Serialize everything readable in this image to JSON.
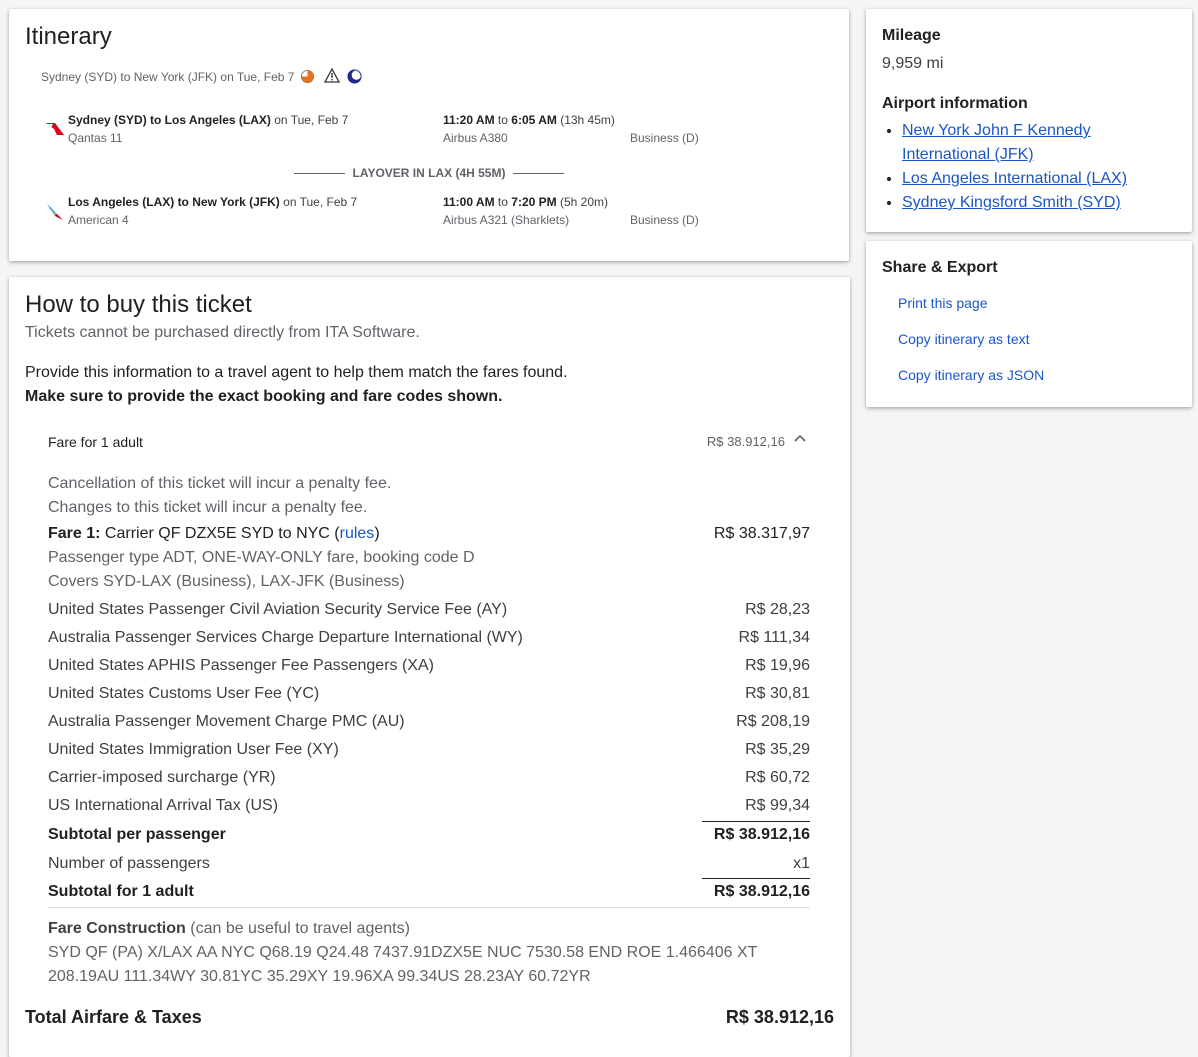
{
  "itinerary": {
    "title": "Itinerary",
    "summary": "Sydney (SYD) to New York (JFK) on Tue, Feb 7",
    "segments": [
      {
        "route": "Sydney (SYD) to Los Angeles (LAX)",
        "date": " on Tue, Feb 7",
        "flight": "Qantas 11",
        "dep": "11:20 AM",
        "to": " to ",
        "arr": "6:05 AM",
        "duration": " (13h 45m)",
        "aircraft": "Airbus A380",
        "cabin": "Business (D)"
      },
      {
        "route": "Los Angeles (LAX) to New York (JFK)",
        "date": " on Tue, Feb 7",
        "flight": "American 4",
        "dep": "11:00 AM",
        "to": " to ",
        "arr": "7:20 PM",
        "duration": " (5h 20m)",
        "aircraft": "Airbus A321 (Sharklets)",
        "cabin": "Business (D)"
      }
    ],
    "layover": "LAYOVER IN LAX (4H 55M)"
  },
  "buy": {
    "title": "How to buy this ticket",
    "subtitle": "Tickets cannot be purchased directly from ITA Software.",
    "info": "Provide this information to a travel agent to help them match the fares found.",
    "info_bold": "Make sure to provide the exact booking and fare codes shown.",
    "fare_for": "Fare for 1 adult",
    "fare_for_amount": "R$ 38.912,16",
    "cancel_note": "Cancellation of this ticket will incur a penalty fee.",
    "change_note": "Changes to this ticket will incur a penalty fee.",
    "fare1_label": "Fare 1:",
    "fare1_text": " Carrier QF DZX5E SYD to NYC (",
    "fare1_rules": "rules",
    "fare1_close": ")",
    "fare1_amount": "R$ 38.317,97",
    "passenger_type": "Passenger type ADT, ONE-WAY-ONLY fare, booking code D",
    "covers": "Covers SYD-LAX (Business), LAX-JFK (Business)",
    "taxes": [
      {
        "label": "United States Passenger Civil Aviation Security Service Fee (AY)",
        "amount": "R$ 28,23"
      },
      {
        "label": "Australia Passenger Services Charge Departure International (WY)",
        "amount": "R$ 111,34"
      },
      {
        "label": "United States APHIS Passenger Fee Passengers (XA)",
        "amount": "R$ 19,96"
      },
      {
        "label": "United States Customs User Fee (YC)",
        "amount": "R$ 30,81"
      },
      {
        "label": "Australia Passenger Movement Charge PMC (AU)",
        "amount": "R$ 208,19"
      },
      {
        "label": "United States Immigration User Fee (XY)",
        "amount": "R$ 35,29"
      },
      {
        "label": "Carrier-imposed surcharge (YR)",
        "amount": "R$ 60,72"
      },
      {
        "label": "US International Arrival Tax (US)",
        "amount": "R$ 99,34"
      }
    ],
    "subtotal_pp_label": "Subtotal per passenger",
    "subtotal_pp_amount": "R$ 38.912,16",
    "num_pass_label": "Number of passengers",
    "num_pass_value": "x1",
    "subtotal_adult_label": "Subtotal for 1 adult",
    "subtotal_adult_amount": "R$ 38.912,16",
    "fc_label": "Fare Construction",
    "fc_note": " (can be useful to travel agents)",
    "fc_line1": "SYD QF (PA) X/LAX AA NYC Q68.19 Q24.48 7437.91DZX5E NUC 7530.58 END ROE 1.466406 XT",
    "fc_line2": "208.19AU 111.34WY 30.81YC 35.29XY 19.96XA 99.34US 28.23AY 60.72YR",
    "total_label": "Total Airfare & Taxes",
    "total_amount": "R$ 38.912,16"
  },
  "mileage": {
    "title": "Mileage",
    "value": "9,959 mi",
    "airport_title": "Airport information",
    "airports": [
      "New York John F Kennedy International (JFK)",
      "Los Angeles International (LAX)",
      "Sydney Kingsford Smith (SYD)"
    ]
  },
  "share": {
    "title": "Share & Export",
    "print": "Print this page",
    "copy_text": "Copy itinerary as text",
    "copy_json": "Copy itinerary as JSON"
  },
  "colors": {
    "link": "#1a56c8",
    "qantas_red": "#e0001b",
    "american_blue": "#0078d2",
    "daylight_orange": "#e8711a",
    "night_navy": "#1c2b8a"
  }
}
